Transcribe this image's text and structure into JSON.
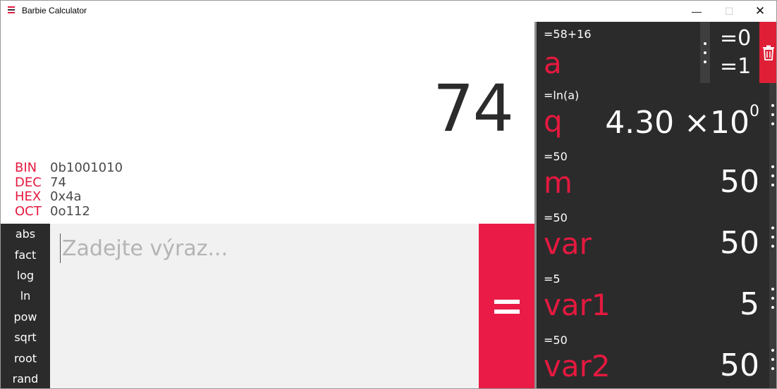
{
  "window": {
    "title": "Barbie Calculator",
    "minimize_glyph": "—",
    "maximize_glyph": "☐",
    "close_glyph": "✕"
  },
  "result": {
    "value": "74"
  },
  "bases": [
    {
      "label": "BIN",
      "value": "0b1001010"
    },
    {
      "label": "DEC",
      "value": "74"
    },
    {
      "label": "HEX",
      "value": "0x4a"
    },
    {
      "label": "OCT",
      "value": "0o112"
    }
  ],
  "functions": [
    "abs",
    "fact",
    "log",
    "ln",
    "pow",
    "sqrt",
    "root",
    "rand"
  ],
  "input": {
    "value": "",
    "placeholder": "Zadejte výraz..."
  },
  "equals_button": {
    "label": "="
  },
  "editing": {
    "expression": "=58+16",
    "name": "a",
    "answers": [
      "=0",
      "=1"
    ],
    "delete_icon": "trash-icon"
  },
  "variables": [
    {
      "expression": "=ln(a)",
      "name": "q",
      "value": "4.30 ×10",
      "exponent": "0"
    },
    {
      "expression": "=50",
      "name": "m",
      "value": "50",
      "exponent": ""
    },
    {
      "expression": "=50",
      "name": "var",
      "value": "50",
      "exponent": ""
    },
    {
      "expression": "=5",
      "name": "var1",
      "value": "5",
      "exponent": ""
    },
    {
      "expression": "=50",
      "name": "var2",
      "value": "50",
      "exponent": ""
    }
  ],
  "colors": {
    "accent": "#e5193f",
    "panel": "#2b2b2b",
    "input_bg": "#f1f1f1",
    "delete": "#de1f36"
  }
}
